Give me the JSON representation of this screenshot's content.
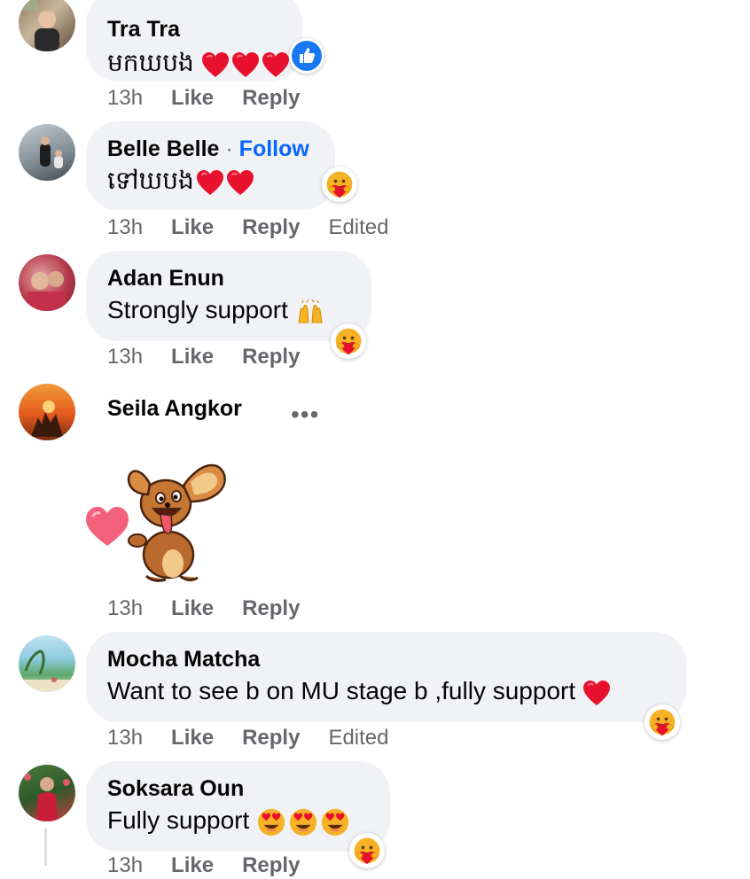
{
  "comments": [
    {
      "name": "Tra Tra",
      "text": "មកឃបង",
      "time": "13h",
      "like": "Like",
      "reply": "Reply",
      "edited": ""
    },
    {
      "name": "Belle Belle",
      "dot": " · ",
      "follow": "Follow",
      "text": "ទៅឃបង",
      "time": "13h",
      "like": "Like",
      "reply": "Reply",
      "edited": "Edited"
    },
    {
      "name": "Adan Enun",
      "text": "Strongly support",
      "time": "13h",
      "like": "Like",
      "reply": "Reply",
      "edited": ""
    },
    {
      "name": "Seila Angkor",
      "more": "•••",
      "time": "13h",
      "like": "Like",
      "reply": "Reply",
      "edited": ""
    },
    {
      "name": "Mocha Matcha",
      "text": "Want to see b on MU stage b ,fully support",
      "time": "13h",
      "like": "Like",
      "reply": "Reply",
      "edited": "Edited"
    },
    {
      "name": "Soksara Oun",
      "text": "Fully support",
      "time": "13h",
      "like": "Like",
      "reply": "Reply",
      "edited": ""
    }
  ],
  "icons": {
    "like_reaction": "thumbs-up-icon",
    "care_reaction": "care-hug-icon",
    "heart": "red-heart-icon",
    "heart_eyes": "heart-eyes-icon",
    "raising_hands": "raising-hands-icon",
    "sticker": "dog-heart-sticker"
  },
  "colors": {
    "bubble": "#f0f2f5",
    "link": "#0866ff",
    "meta": "#65676b",
    "heart": "#e0245e",
    "like_blue": "#1877f2"
  }
}
